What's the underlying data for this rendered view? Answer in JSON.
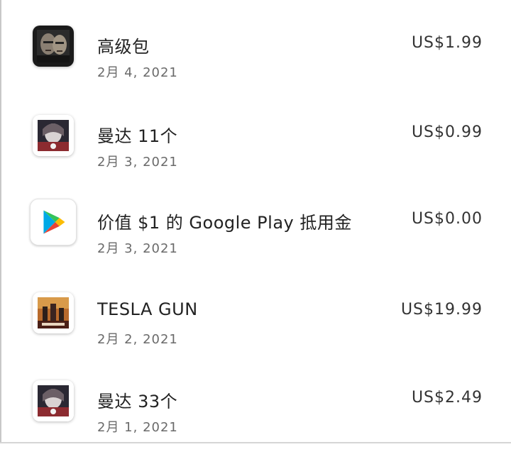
{
  "purchases": [
    {
      "title": "高级包",
      "date": "2月 4, 2021",
      "price": "US$1.99",
      "icon": "game-icon-zombie-faces"
    },
    {
      "title": "曼达 11个",
      "date": "2月 3, 2021",
      "price": "US$0.99",
      "icon": "game-icon-character"
    },
    {
      "title": "价值 $1 的 Google Play 抵用金",
      "date": "2月 3, 2021",
      "price": "US$0.00",
      "icon": "google-play-icon"
    },
    {
      "title": "TESLA GUN",
      "date": "2月 2, 2021",
      "price": "US$19.99",
      "icon": "game-icon-unkilled"
    },
    {
      "title": "曼达 33个",
      "date": "2月 1, 2021",
      "price": "US$2.49",
      "icon": "game-icon-character"
    }
  ]
}
